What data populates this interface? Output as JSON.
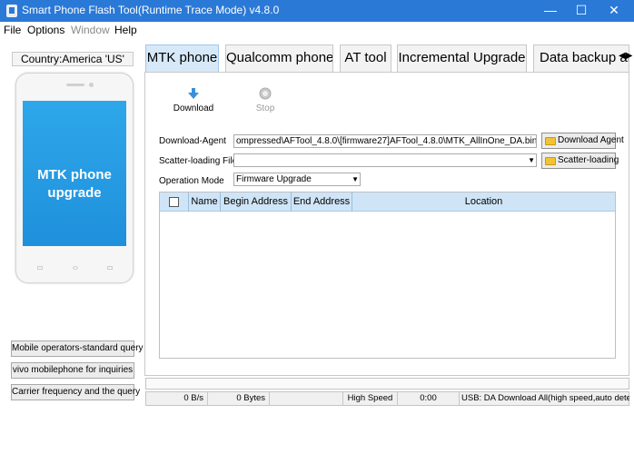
{
  "window": {
    "title": "Smart Phone Flash Tool(Runtime Trace Mode)  v4.8.0",
    "controls": {
      "minimize": "—",
      "maximize": "☐",
      "close": "✕"
    }
  },
  "menu": [
    "File",
    "Options",
    "Window",
    "Help"
  ],
  "left_panel": {
    "country": "Country:America 'US'",
    "phone_screen_text_line1": "MTK phone",
    "phone_screen_text_line2": "upgrade",
    "buttons": [
      "Mobile operators-standard query",
      "vivo mobilephone for inquiries",
      "Carrier frequency and the query"
    ]
  },
  "tabs": [
    "MTK phone",
    "Qualcomm phone",
    "AT tool",
    "Incremental Upgrade",
    "Data backup and"
  ],
  "active_tab": "MTK phone",
  "toolbar": {
    "download": "Download",
    "stop": "Stop",
    "download_icon": "down-arrow-icon",
    "stop_icon": "stop-circle-icon"
  },
  "form": {
    "download_agent_label": "Download-Agent",
    "download_agent_value": "ompressed\\AFTool_4.8.0\\[firmware27]AFTool_4.8.0\\MTK_AllInOne_DA.bin",
    "download_agent_button": "Download Agent",
    "scatter_label": "Scatter-loading File",
    "scatter_value": "",
    "scatter_button": "Scatter-loading",
    "operation_label": "Operation Mode",
    "operation_value": "Firmware Upgrade"
  },
  "table": {
    "columns": [
      "Name",
      "Begin Address",
      "End Address",
      "Location"
    ],
    "rows": []
  },
  "status_bar": {
    "speed": "0 B/s",
    "bytes": "0 Bytes",
    "mode": "High Speed",
    "time": "0:00",
    "usb": "USB: DA Download All(high speed,auto detect)"
  },
  "colors": {
    "titlebar": "#2b79d6",
    "active_tab": "#d7e9f9",
    "table_header": "#cfe5f7",
    "phone_screen": "#1f90dc"
  }
}
